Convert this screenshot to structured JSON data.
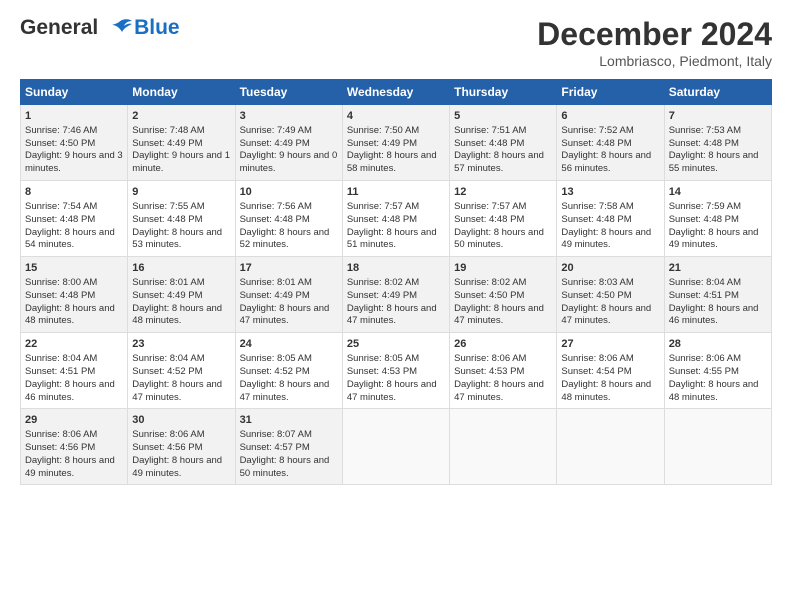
{
  "header": {
    "logo_line1": "General",
    "logo_line2": "Blue",
    "month": "December 2024",
    "location": "Lombriasco, Piedmont, Italy"
  },
  "days_of_week": [
    "Sunday",
    "Monday",
    "Tuesday",
    "Wednesday",
    "Thursday",
    "Friday",
    "Saturday"
  ],
  "weeks": [
    [
      {
        "day": "1",
        "sunrise": "Sunrise: 7:46 AM",
        "sunset": "Sunset: 4:50 PM",
        "daylight": "Daylight: 9 hours and 3 minutes."
      },
      {
        "day": "2",
        "sunrise": "Sunrise: 7:48 AM",
        "sunset": "Sunset: 4:49 PM",
        "daylight": "Daylight: 9 hours and 1 minute."
      },
      {
        "day": "3",
        "sunrise": "Sunrise: 7:49 AM",
        "sunset": "Sunset: 4:49 PM",
        "daylight": "Daylight: 9 hours and 0 minutes."
      },
      {
        "day": "4",
        "sunrise": "Sunrise: 7:50 AM",
        "sunset": "Sunset: 4:49 PM",
        "daylight": "Daylight: 8 hours and 58 minutes."
      },
      {
        "day": "5",
        "sunrise": "Sunrise: 7:51 AM",
        "sunset": "Sunset: 4:48 PM",
        "daylight": "Daylight: 8 hours and 57 minutes."
      },
      {
        "day": "6",
        "sunrise": "Sunrise: 7:52 AM",
        "sunset": "Sunset: 4:48 PM",
        "daylight": "Daylight: 8 hours and 56 minutes."
      },
      {
        "day": "7",
        "sunrise": "Sunrise: 7:53 AM",
        "sunset": "Sunset: 4:48 PM",
        "daylight": "Daylight: 8 hours and 55 minutes."
      }
    ],
    [
      {
        "day": "8",
        "sunrise": "Sunrise: 7:54 AM",
        "sunset": "Sunset: 4:48 PM",
        "daylight": "Daylight: 8 hours and 54 minutes."
      },
      {
        "day": "9",
        "sunrise": "Sunrise: 7:55 AM",
        "sunset": "Sunset: 4:48 PM",
        "daylight": "Daylight: 8 hours and 53 minutes."
      },
      {
        "day": "10",
        "sunrise": "Sunrise: 7:56 AM",
        "sunset": "Sunset: 4:48 PM",
        "daylight": "Daylight: 8 hours and 52 minutes."
      },
      {
        "day": "11",
        "sunrise": "Sunrise: 7:57 AM",
        "sunset": "Sunset: 4:48 PM",
        "daylight": "Daylight: 8 hours and 51 minutes."
      },
      {
        "day": "12",
        "sunrise": "Sunrise: 7:57 AM",
        "sunset": "Sunset: 4:48 PM",
        "daylight": "Daylight: 8 hours and 50 minutes."
      },
      {
        "day": "13",
        "sunrise": "Sunrise: 7:58 AM",
        "sunset": "Sunset: 4:48 PM",
        "daylight": "Daylight: 8 hours and 49 minutes."
      },
      {
        "day": "14",
        "sunrise": "Sunrise: 7:59 AM",
        "sunset": "Sunset: 4:48 PM",
        "daylight": "Daylight: 8 hours and 49 minutes."
      }
    ],
    [
      {
        "day": "15",
        "sunrise": "Sunrise: 8:00 AM",
        "sunset": "Sunset: 4:48 PM",
        "daylight": "Daylight: 8 hours and 48 minutes."
      },
      {
        "day": "16",
        "sunrise": "Sunrise: 8:01 AM",
        "sunset": "Sunset: 4:49 PM",
        "daylight": "Daylight: 8 hours and 48 minutes."
      },
      {
        "day": "17",
        "sunrise": "Sunrise: 8:01 AM",
        "sunset": "Sunset: 4:49 PM",
        "daylight": "Daylight: 8 hours and 47 minutes."
      },
      {
        "day": "18",
        "sunrise": "Sunrise: 8:02 AM",
        "sunset": "Sunset: 4:49 PM",
        "daylight": "Daylight: 8 hours and 47 minutes."
      },
      {
        "day": "19",
        "sunrise": "Sunrise: 8:02 AM",
        "sunset": "Sunset: 4:50 PM",
        "daylight": "Daylight: 8 hours and 47 minutes."
      },
      {
        "day": "20",
        "sunrise": "Sunrise: 8:03 AM",
        "sunset": "Sunset: 4:50 PM",
        "daylight": "Daylight: 8 hours and 47 minutes."
      },
      {
        "day": "21",
        "sunrise": "Sunrise: 8:04 AM",
        "sunset": "Sunset: 4:51 PM",
        "daylight": "Daylight: 8 hours and 46 minutes."
      }
    ],
    [
      {
        "day": "22",
        "sunrise": "Sunrise: 8:04 AM",
        "sunset": "Sunset: 4:51 PM",
        "daylight": "Daylight: 8 hours and 46 minutes."
      },
      {
        "day": "23",
        "sunrise": "Sunrise: 8:04 AM",
        "sunset": "Sunset: 4:52 PM",
        "daylight": "Daylight: 8 hours and 47 minutes."
      },
      {
        "day": "24",
        "sunrise": "Sunrise: 8:05 AM",
        "sunset": "Sunset: 4:52 PM",
        "daylight": "Daylight: 8 hours and 47 minutes."
      },
      {
        "day": "25",
        "sunrise": "Sunrise: 8:05 AM",
        "sunset": "Sunset: 4:53 PM",
        "daylight": "Daylight: 8 hours and 47 minutes."
      },
      {
        "day": "26",
        "sunrise": "Sunrise: 8:06 AM",
        "sunset": "Sunset: 4:53 PM",
        "daylight": "Daylight: 8 hours and 47 minutes."
      },
      {
        "day": "27",
        "sunrise": "Sunrise: 8:06 AM",
        "sunset": "Sunset: 4:54 PM",
        "daylight": "Daylight: 8 hours and 48 minutes."
      },
      {
        "day": "28",
        "sunrise": "Sunrise: 8:06 AM",
        "sunset": "Sunset: 4:55 PM",
        "daylight": "Daylight: 8 hours and 48 minutes."
      }
    ],
    [
      {
        "day": "29",
        "sunrise": "Sunrise: 8:06 AM",
        "sunset": "Sunset: 4:56 PM",
        "daylight": "Daylight: 8 hours and 49 minutes."
      },
      {
        "day": "30",
        "sunrise": "Sunrise: 8:06 AM",
        "sunset": "Sunset: 4:56 PM",
        "daylight": "Daylight: 8 hours and 49 minutes."
      },
      {
        "day": "31",
        "sunrise": "Sunrise: 8:07 AM",
        "sunset": "Sunset: 4:57 PM",
        "daylight": "Daylight: 8 hours and 50 minutes."
      },
      null,
      null,
      null,
      null
    ]
  ]
}
